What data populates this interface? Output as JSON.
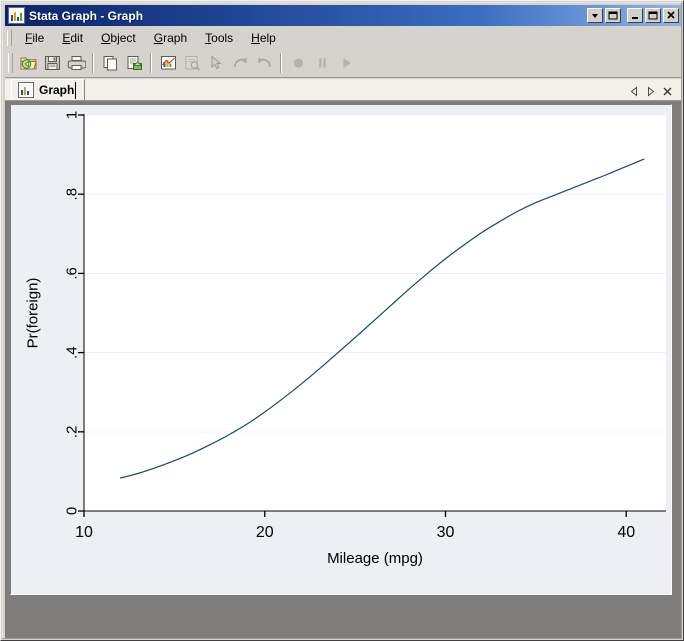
{
  "window": {
    "title": "Stata Graph - Graph",
    "title_icon": "bar-chart-icon",
    "controls": {
      "dropdown_label": "▼",
      "restore_label": "Restore",
      "minimize_label": "Minimize",
      "maximize_label": "Maximize",
      "close_label": "Close"
    }
  },
  "menu": {
    "items": [
      {
        "label": "File",
        "accel": "F"
      },
      {
        "label": "Edit",
        "accel": "E"
      },
      {
        "label": "Object",
        "accel": "O"
      },
      {
        "label": "Graph",
        "accel": "G"
      },
      {
        "label": "Tools",
        "accel": "T"
      },
      {
        "label": "Help",
        "accel": "H"
      }
    ]
  },
  "toolbar": {
    "buttons": [
      {
        "name": "open-graph-button",
        "icon": "open-folder-icon",
        "enabled": true,
        "tooltip": "Open"
      },
      {
        "name": "save-graph-button",
        "icon": "save-floppy-icon",
        "enabled": true,
        "tooltip": "Save"
      },
      {
        "name": "print-graph-button",
        "icon": "printer-icon",
        "enabled": true,
        "tooltip": "Print"
      },
      {
        "name": "copy-button",
        "icon": "copy-pages-icon",
        "enabled": true,
        "tooltip": "Copy"
      },
      {
        "name": "export-button",
        "icon": "export-page-icon",
        "enabled": true,
        "tooltip": "Export"
      },
      {
        "name": "graph-editor-button",
        "icon": "chart-edit-icon",
        "enabled": true,
        "tooltip": "Start Graph Editor"
      },
      {
        "name": "inspector-button",
        "icon": "inspector-icon",
        "enabled": false,
        "tooltip": "Object Browser"
      },
      {
        "name": "pointer-tool-button",
        "icon": "pointer-icon",
        "enabled": false,
        "tooltip": "Pointer Tool"
      },
      {
        "name": "redo-button",
        "icon": "redo-arrow-icon",
        "enabled": false,
        "tooltip": "Redo"
      },
      {
        "name": "undo-button",
        "icon": "undo-arrow-icon",
        "enabled": false,
        "tooltip": "Undo"
      },
      {
        "name": "record-button",
        "icon": "record-circle-icon",
        "enabled": false,
        "tooltip": "Record"
      },
      {
        "name": "pause-button",
        "icon": "pause-bars-icon",
        "enabled": false,
        "tooltip": "Pause"
      },
      {
        "name": "play-button",
        "icon": "play-triangle-icon",
        "enabled": false,
        "tooltip": "Play"
      }
    ]
  },
  "tabs": {
    "active": "Graph",
    "items": [
      {
        "label": "Graph",
        "icon": "bar-chart-icon"
      }
    ],
    "nav": {
      "prev_label": "◁",
      "next_label": "▷",
      "close_label": "×"
    }
  },
  "colors": {
    "title_bar_start": "#0a246a",
    "title_bar_end": "#8fb4e8",
    "window_face": "#d6d3ce",
    "client_background": "#807d7d",
    "graph_background": "#eceff3",
    "plot_background": "#ffffff",
    "line_color": "#1a476f",
    "grid_color": "#eef0f4",
    "axis_color": "#000000"
  },
  "chart_data": {
    "type": "line",
    "title": "",
    "subtitle": "",
    "xlabel": "Mileage (mpg)",
    "ylabel": "Pr(foreign)",
    "xlim": [
      10,
      42.2
    ],
    "ylim": [
      0,
      1
    ],
    "xticks": [
      10,
      20,
      30,
      40
    ],
    "xticklabels": [
      "10",
      "20",
      "30",
      "40"
    ],
    "yticks": [
      0,
      0.2,
      0.4,
      0.6,
      0.8,
      1
    ],
    "yticklabels": [
      "0",
      ".2",
      ".4",
      ".6",
      ".8",
      "1"
    ],
    "grid": "horizontal",
    "legend": null,
    "series": [
      {
        "name": "Pr(foreign)",
        "color": "#1a476f",
        "x": [
          12.0,
          13.0,
          14.0,
          15.0,
          16.0,
          17.0,
          18.0,
          19.0,
          20.0,
          21.0,
          22.0,
          23.0,
          24.0,
          25.0,
          26.0,
          27.0,
          28.0,
          29.0,
          30.0,
          31.0,
          32.0,
          33.0,
          34.0,
          35.0,
          36.0,
          37.0,
          38.0,
          39.0,
          40.0,
          41.0
        ],
        "y": [
          0.083,
          0.095,
          0.11,
          0.127,
          0.146,
          0.168,
          0.192,
          0.219,
          0.25,
          0.284,
          0.32,
          0.358,
          0.398,
          0.438,
          0.479,
          0.52,
          0.561,
          0.6,
          0.637,
          0.671,
          0.703,
          0.731,
          0.757,
          0.779,
          0.797,
          0.815,
          0.833,
          0.851,
          0.87,
          0.889
        ]
      }
    ]
  }
}
